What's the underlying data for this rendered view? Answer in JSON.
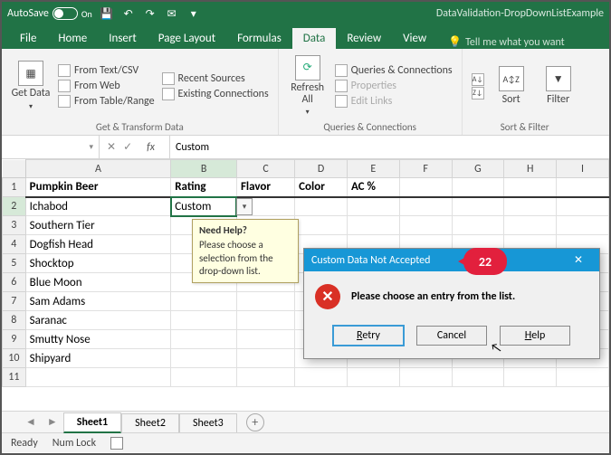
{
  "titlebar": {
    "autosave_label": "AutoSave",
    "autosave_state": "On",
    "doc_title": "DataValidation-DropDownListExample"
  },
  "ribbon": {
    "tabs": [
      "File",
      "Home",
      "Insert",
      "Page Layout",
      "Formulas",
      "Data",
      "Review",
      "View"
    ],
    "active_tab": "Data",
    "tell_me": "Tell me what you want",
    "groups": {
      "get_transform": {
        "label": "Get & Transform Data",
        "get_data": "Get Data",
        "from_text": "From Text/CSV",
        "from_web": "From Web",
        "from_table": "From Table/Range",
        "recent": "Recent Sources",
        "existing": "Existing Connections"
      },
      "queries": {
        "label": "Queries & Connections",
        "refresh": "Refresh All",
        "qc": "Queries & Connections",
        "props": "Properties",
        "edit_links": "Edit Links"
      },
      "sort_filter": {
        "label": "Sort & Filter",
        "sort": "Sort",
        "filter": "Filter"
      }
    }
  },
  "formula_bar": {
    "namebox_value": "",
    "fx_label": "fx",
    "formula_value": "Custom"
  },
  "grid": {
    "col_headers": [
      "A",
      "B",
      "C",
      "D",
      "E",
      "F",
      "G",
      "H",
      "I"
    ],
    "rows": [
      {
        "r": 1,
        "cells": [
          "Pumpkin Beer",
          "Rating",
          "Flavor",
          "Color",
          "AC %",
          "",
          "",
          "",
          ""
        ],
        "header": true
      },
      {
        "r": 2,
        "cells": [
          "Ichabod",
          "Custom",
          "",
          "",
          "",
          "",
          "",
          "",
          ""
        ],
        "sel_col": 1
      },
      {
        "r": 3,
        "cells": [
          "Southern Tier",
          "",
          "",
          "",
          "",
          "",
          "",
          "",
          ""
        ]
      },
      {
        "r": 4,
        "cells": [
          "Dogfish Head",
          "",
          "",
          "",
          "",
          "",
          "",
          "",
          ""
        ]
      },
      {
        "r": 5,
        "cells": [
          "Shocktop",
          "",
          "",
          "",
          "",
          "",
          "",
          "",
          ""
        ]
      },
      {
        "r": 6,
        "cells": [
          "Blue Moon",
          "",
          "",
          "",
          "",
          "",
          "",
          "",
          ""
        ]
      },
      {
        "r": 7,
        "cells": [
          "Sam Adams",
          "",
          "",
          "",
          "",
          "",
          "",
          "",
          ""
        ]
      },
      {
        "r": 8,
        "cells": [
          "Saranac",
          "",
          "",
          "",
          "",
          "",
          "",
          "",
          ""
        ]
      },
      {
        "r": 9,
        "cells": [
          "Smutty Nose",
          "",
          "",
          "",
          "",
          "",
          "",
          "",
          ""
        ]
      },
      {
        "r": 10,
        "cells": [
          "Shipyard",
          "",
          "",
          "",
          "",
          "",
          "",
          "",
          ""
        ]
      },
      {
        "r": 11,
        "cells": [
          "",
          "",
          "",
          "",
          "",
          "",
          "",
          "",
          ""
        ]
      }
    ]
  },
  "input_message": {
    "title": "Need Help?",
    "body": "Please choose a selection from the drop-down list."
  },
  "dialog": {
    "title": "Custom Data Not Accepted",
    "message": "Please choose an entry from the list.",
    "retry": "Retry",
    "cancel": "Cancel",
    "help": "Help"
  },
  "annotation": {
    "num": "22"
  },
  "sheet_tabs": {
    "tabs": [
      "Sheet1",
      "Sheet2",
      "Sheet3"
    ],
    "active": 0
  },
  "statusbar": {
    "ready": "Ready",
    "numlock": "Num Lock"
  }
}
